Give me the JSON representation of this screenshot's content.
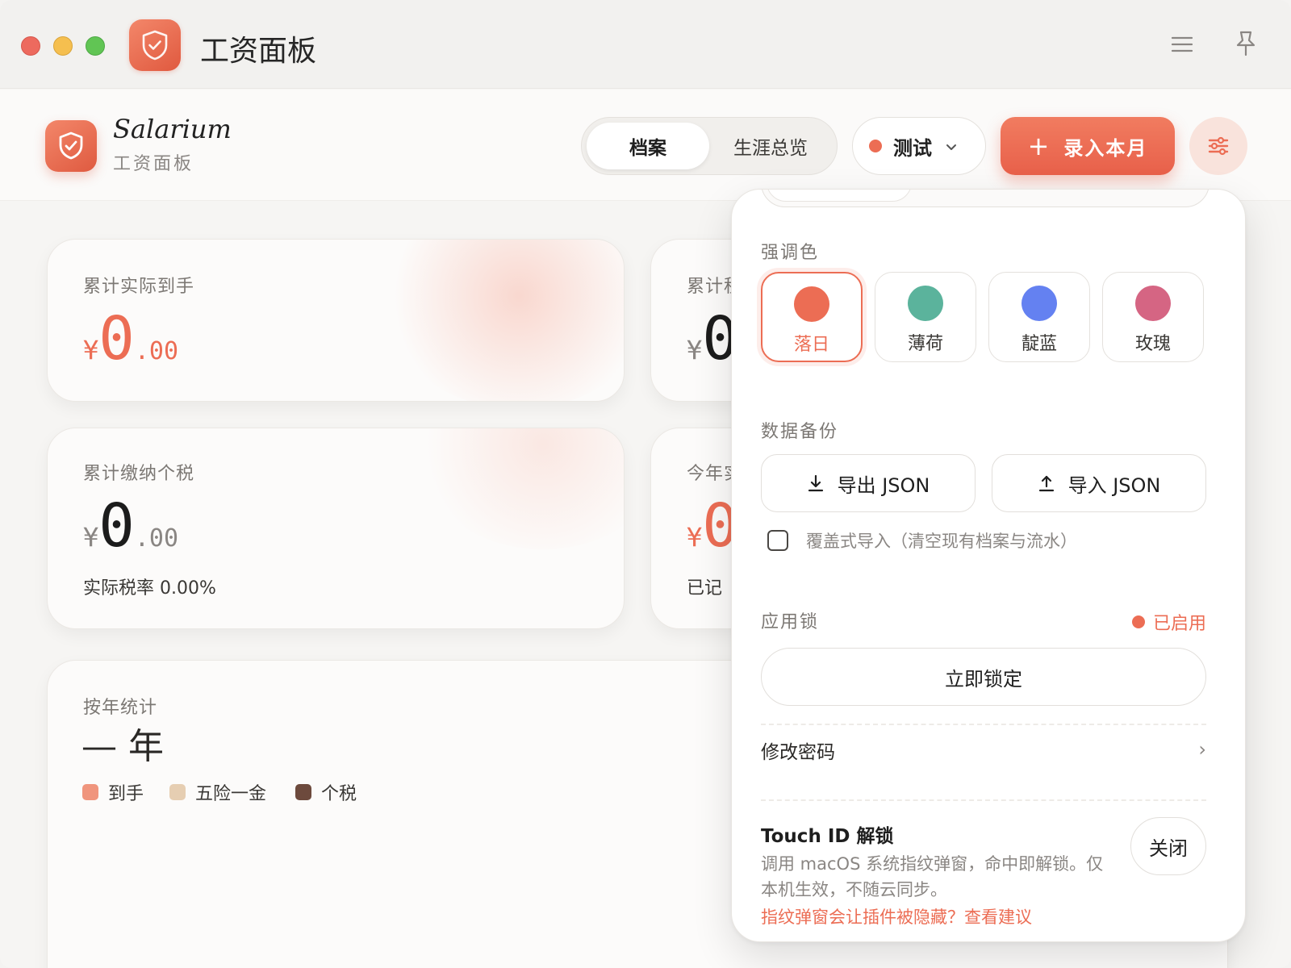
{
  "window": {
    "title": "工资面板",
    "colors": {
      "accent": "#ec6d54"
    }
  },
  "header": {
    "brand_name": "Salarium",
    "brand_sub": "工资面板",
    "tabs": [
      {
        "label": "档案",
        "active": true
      },
      {
        "label": "生涯总览",
        "active": false
      }
    ],
    "profile": "测试",
    "add_button": "录入本月",
    "icons": [
      "menu-icon",
      "pin-icon",
      "shield-check-icon",
      "chevron-down-icon",
      "plus-icon",
      "sliders-icon"
    ]
  },
  "cards": {
    "net": {
      "label": "累计实际到手",
      "currency": "¥",
      "integer": "0",
      "decimals": ".00"
    },
    "card2": {
      "label": "累计税",
      "currency": "¥",
      "integer": "0"
    },
    "tax": {
      "label": "累计缴纳个税",
      "currency": "¥",
      "integer": "0",
      "decimals": ".00",
      "note": "实际税率 0.00%"
    },
    "card4": {
      "label": "今年实",
      "currency": "¥",
      "integer": "0",
      "note": "已记"
    },
    "yearly": {
      "label": "按年统计",
      "year": "— 年",
      "legend": [
        {
          "label": "到手",
          "color": "#f0957d"
        },
        {
          "label": "五险一金",
          "color": "#e6ceb2"
        },
        {
          "label": "个税",
          "color": "#6d4a3d"
        }
      ]
    }
  },
  "settings": {
    "accent_title": "强调色",
    "swatches": [
      {
        "label": "落日",
        "color": "#ec6d54",
        "selected": true
      },
      {
        "label": "薄荷",
        "color": "#5bb39c",
        "selected": false
      },
      {
        "label": "靛蓝",
        "color": "#6481f1",
        "selected": false
      },
      {
        "label": "玫瑰",
        "color": "#d56583",
        "selected": false
      }
    ],
    "backup_title": "数据备份",
    "export_label": "导出 JSON",
    "import_label": "导入 JSON",
    "overwrite_label": "覆盖式导入（清空现有档案与流水）",
    "overwrite_checked": false,
    "lock_title": "应用锁",
    "lock_status": "已启用",
    "lock_now": "立即锁定",
    "change_password": "修改密码",
    "change_password_chevron": "›",
    "touch_id_title": "Touch ID 解锁",
    "touch_id_desc": "调用 macOS 系统指纹弹窗，命中即解锁。仅本机生效，不随云同步。",
    "touch_id_link": "指纹弹窗会让插件被隐藏？查看建议",
    "touch_id_toggle": "关闭"
  }
}
